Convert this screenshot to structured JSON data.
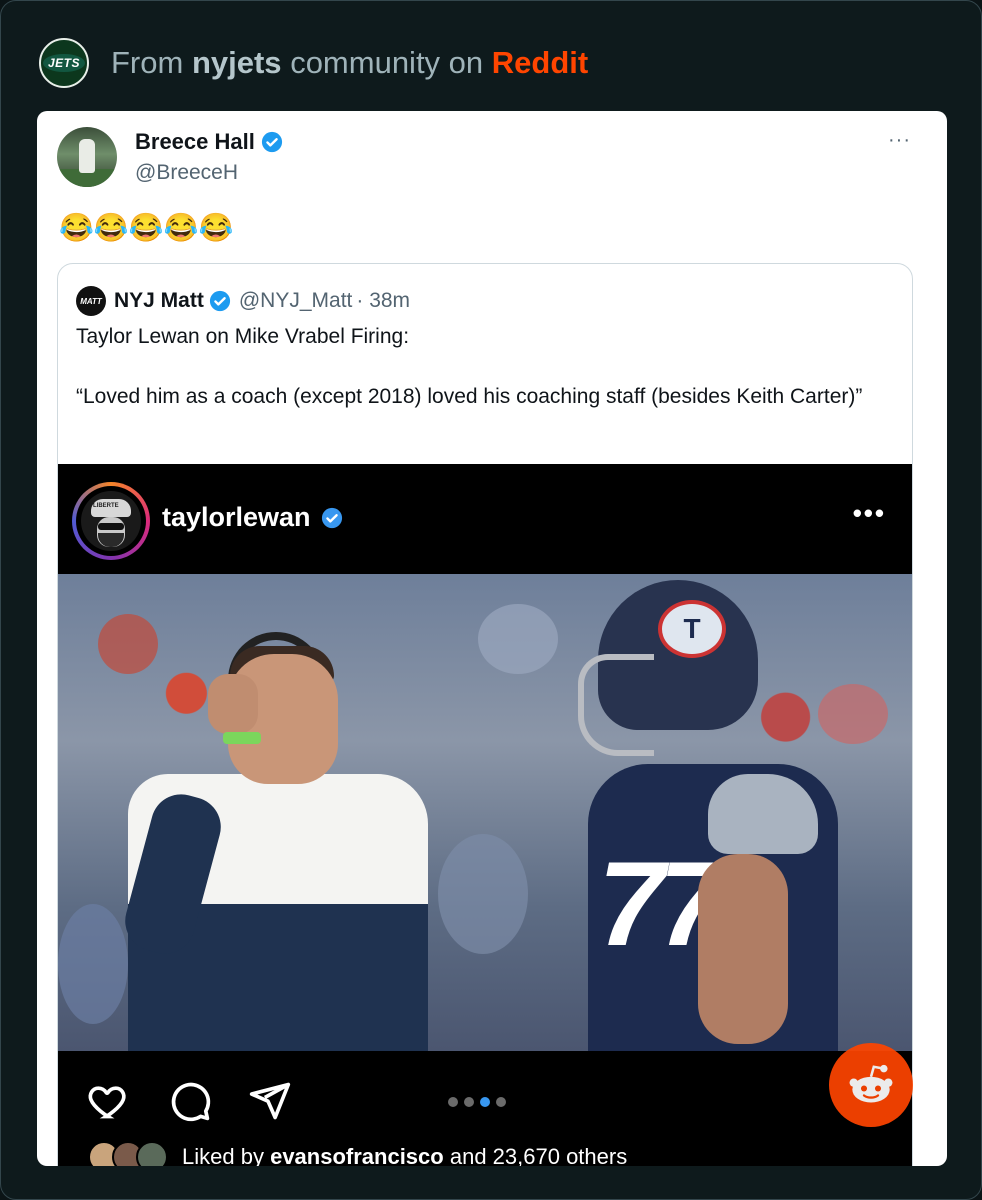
{
  "header": {
    "from": "From",
    "community": "nyjets",
    "community_suffix": "community on",
    "platform": "Reddit",
    "logo_text": "JETS"
  },
  "tweet": {
    "author_name": "Breece Hall",
    "author_handle": "@BreeceH",
    "more": "···",
    "text": "😂😂😂😂😂"
  },
  "quoted": {
    "author_name": "NYJ Matt",
    "author_handle": "@NYJ_Matt",
    "time": "· 38m",
    "avatar_text": "MATT",
    "line1": "Taylor Lewan on Mike Vrabel Firing:",
    "line2": "“Loved him as a coach (except 2018) loved his coaching staff (besides Keith Carter)”"
  },
  "instagram": {
    "username": "taylorlewan",
    "more": "•••",
    "cap_text": "LIBERTE",
    "photo": {
      "jersey_number": "77",
      "helmet_logo": "T"
    },
    "carousel": {
      "count": 4,
      "active": 2
    },
    "likes_prefix": "Liked by",
    "likes_user": "evansofrancisco",
    "likes_suffix": "and 23,670 others"
  },
  "colors": {
    "reddit_orange": "#ff4500",
    "twitter_verified": "#1d9bf0",
    "instagram_blue": "#3897f0"
  },
  "icons": [
    "jets-logo",
    "verified-badge",
    "more-icon",
    "heart-icon",
    "comment-icon",
    "share-icon",
    "reddit-snoo-icon"
  ]
}
